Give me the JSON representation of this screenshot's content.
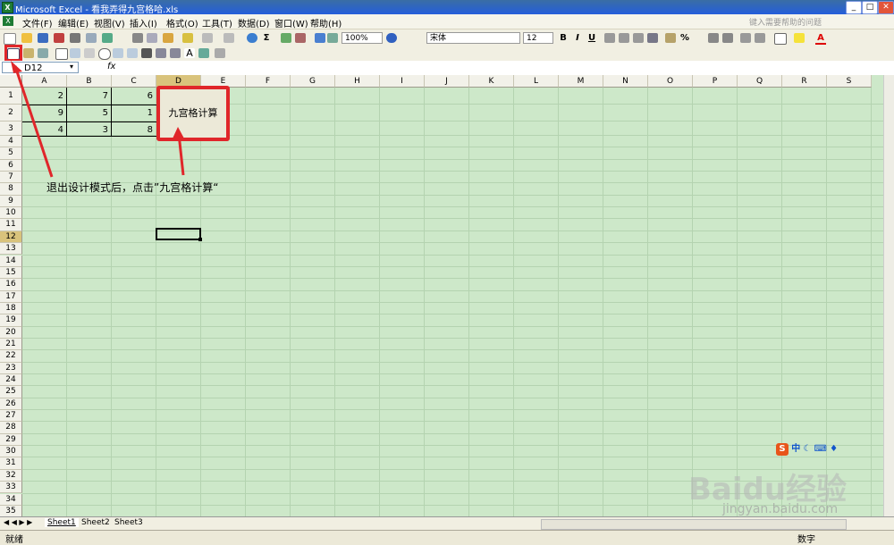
{
  "window": {
    "title": "Microsoft Excel - 看我弄得九宫格哈.xls",
    "min": "_",
    "max": "□",
    "close": "✕"
  },
  "menu": [
    "文件(F)",
    "编辑(E)",
    "视图(V)",
    "插入(I)",
    "格式(O)",
    "工具(T)",
    "数据(D)",
    "窗口(W)",
    "帮助(H)"
  ],
  "help_placeholder": "键入需要帮助的问题",
  "toolbar": {
    "zoom": "100%",
    "font": "宋体",
    "size": "12",
    "bold": "B",
    "italic": "I",
    "underline": "U",
    "percent": "%",
    "sigma": "Σ",
    "font_color": "A"
  },
  "formula_bar": {
    "name_box": "D12",
    "fx": "fx"
  },
  "columns": [
    "A",
    "B",
    "C",
    "D",
    "E",
    "F",
    "G",
    "H",
    "I",
    "J",
    "K",
    "L",
    "M",
    "N",
    "O",
    "P",
    "Q",
    "R",
    "S"
  ],
  "rows": [
    "1",
    "2",
    "3",
    "4",
    "5",
    "6",
    "7",
    "8",
    "9",
    "10",
    "11",
    "12",
    "13",
    "14",
    "15",
    "16",
    "17",
    "18",
    "19",
    "20",
    "21",
    "22",
    "23",
    "24",
    "25",
    "26",
    "27",
    "28",
    "29",
    "30",
    "31",
    "32",
    "33",
    "34",
    "35"
  ],
  "cells": {
    "A1": "2",
    "B1": "7",
    "C1": "6",
    "A2": "9",
    "B2": "5",
    "C2": "1",
    "A3": "4",
    "B3": "3",
    "C3": "8"
  },
  "sheet_button": "九宫格计算",
  "annotation": "退出设计模式后，点击”九宫格计算“",
  "sheets": [
    "Sheet1",
    "Sheet2",
    "Sheet3"
  ],
  "status": {
    "left": "就绪",
    "right": "数字"
  },
  "ime": {
    "mode": "中"
  },
  "watermark": {
    "brand": "Baidu经验",
    "url": "jingyan.baidu.com"
  },
  "colors": {
    "grid_bg": "#CDE8C9",
    "highlight": "#e0262a",
    "title_bar": "#245edb"
  }
}
